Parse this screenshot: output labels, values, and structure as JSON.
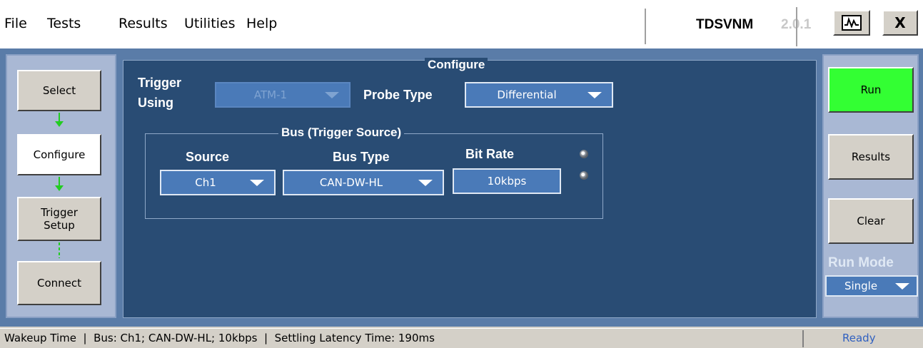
{
  "menu": {
    "file": "File",
    "tests": "Tests",
    "results": "Results",
    "utilities": "Utilities",
    "help": "Help",
    "app_name": "TDSVNM",
    "app_version": "2.0.1",
    "scope_icon": "scope-waveform-icon",
    "close_label": "X"
  },
  "left_nav": {
    "select": "Select",
    "configure": "Configure",
    "trigger_setup": "Trigger\nSetup",
    "connect": "Connect"
  },
  "configure": {
    "title": "Configure",
    "trigger_using_label": "Trigger\nUsing",
    "trigger_using_value": "ATM-1",
    "probe_type_label": "Probe Type",
    "probe_type_value": "Differential",
    "bus_group_title": "Bus (Trigger Source)",
    "source_label": "Source",
    "source_value": "Ch1",
    "bus_type_label": "Bus Type",
    "bus_type_value": "CAN-DW-HL",
    "bit_rate_label": "Bit Rate",
    "bit_rate_value": "10kbps"
  },
  "right_panel": {
    "run": "Run",
    "results": "Results",
    "clear": "Clear",
    "run_mode_label": "Run Mode",
    "run_mode_value": "Single"
  },
  "status": {
    "text": "Wakeup Time  |  Bus: Ch1; CAN-DW-HL; 10kbps  |  Settling Latency Time: 190ms",
    "state": "Ready"
  },
  "colors": {
    "run_button": "#33ff33",
    "panel_bg": "#294c74",
    "dropdown_bg": "#4a7ab8"
  }
}
